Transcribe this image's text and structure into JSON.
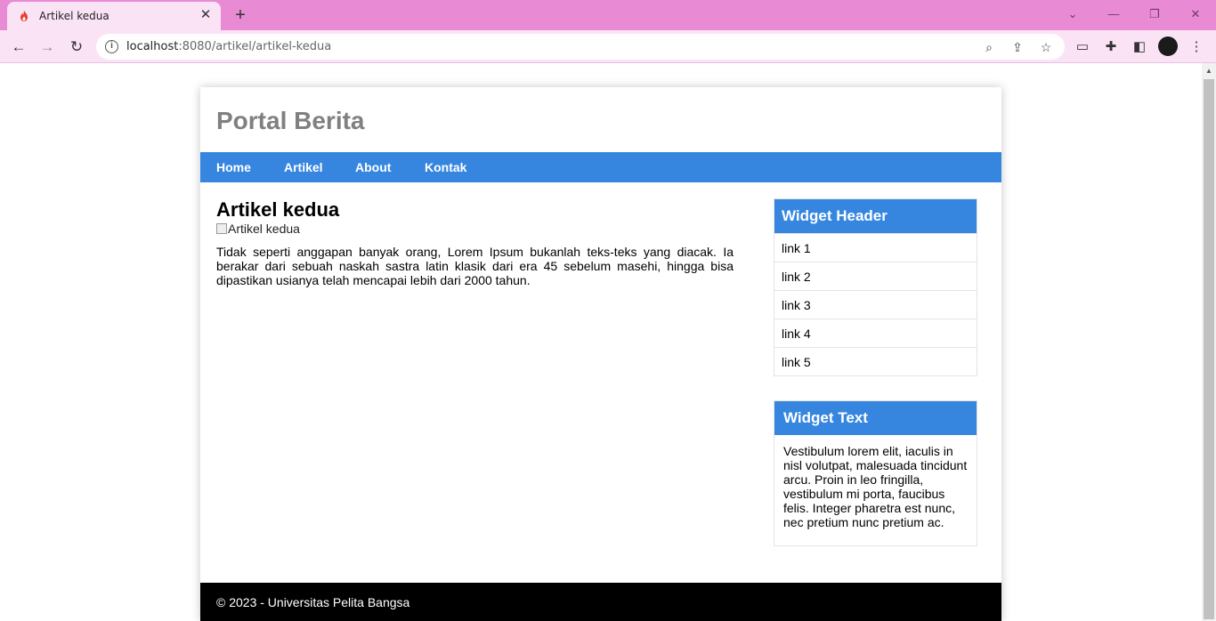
{
  "browser": {
    "tab_title": "Artikel kedua",
    "url_host": "localhost",
    "url_rest": ":8080/artikel/artikel-kedua"
  },
  "site": {
    "title": "Portal Berita",
    "nav": [
      "Home",
      "Artikel",
      "About",
      "Kontak"
    ]
  },
  "article": {
    "title": "Artikel kedua",
    "image_alt": "Artikel kedua",
    "body": "Tidak seperti anggapan banyak orang, Lorem Ipsum bukanlah teks-teks yang diacak. Ia berakar dari sebuah naskah sastra latin klasik dari era 45 sebelum masehi, hingga bisa dipastikan usianya telah mencapai lebih dari 2000 tahun."
  },
  "widget_links": {
    "header": "Widget Header",
    "links": [
      "link 1",
      "link 2",
      "link 3",
      "link 4",
      "link 5"
    ]
  },
  "widget_text": {
    "header": "Widget Text",
    "body": "Vestibulum lorem elit, iaculis in nisl volutpat, malesuada tincidunt arcu. Proin in leo fringilla, vestibulum mi porta, faucibus felis. Integer pharetra est nunc, nec pretium nunc pretium ac."
  },
  "footer": {
    "text": "© 2023 - Universitas Pelita Bangsa"
  },
  "colors": {
    "accent": "#3686e0",
    "chrome": "#e98ad5",
    "footer": "#000000"
  }
}
